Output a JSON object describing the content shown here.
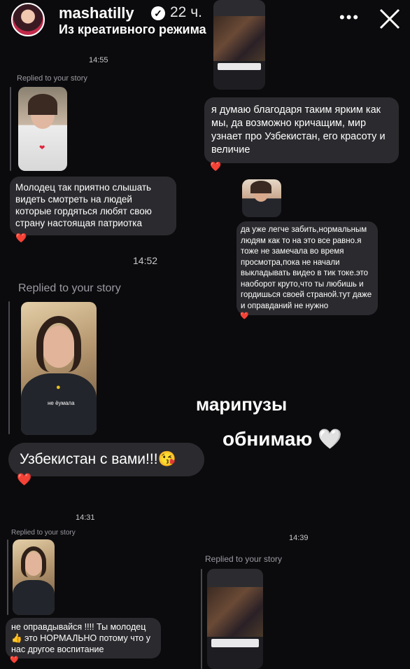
{
  "header": {
    "username": "mashatilly",
    "time_ago": "22 ч.",
    "subtitle": "Из креативного режима",
    "subtitle_chevron": "›",
    "more": "•••"
  },
  "chat": {
    "time_1": "14:55",
    "replied_1": "Replied to your story",
    "msg_1": "Молодец так приятно слышать видеть смотреть на людей которые гордяться любят свою страну настоящая патриотка",
    "msg_right_1": "я думаю благодаря таким ярким как мы, да возможно кричащим, мир узнает про Узбекистан, его красоту и величие",
    "msg_right_2": "да уже легче забить,нормальным людям как то на это все равно.я тоже не замечала во время просмотра,пока не начали выкладывать видео в тик токе.это наоборот круто,что ты любишь и гордишься своей страной.тут даже и оправданий не нужно",
    "time_2": "14:52",
    "replied_2": "Replied to your story",
    "msg_2": "Узбекистан с вами!!!😘",
    "time_3": "14:31",
    "replied_3": "Replied to your story",
    "msg_3": "не оправдывайся !!!! Ты молодец 👍 это НОРМАЛЬНО потому что у нас другое воспитание",
    "time_4": "14:39",
    "replied_4": "Replied to your story",
    "shirt_text": "не ёумала",
    "heart": "❤️"
  },
  "overlay": {
    "line1": "марипузы",
    "line2": "обнимаю 🤍"
  }
}
